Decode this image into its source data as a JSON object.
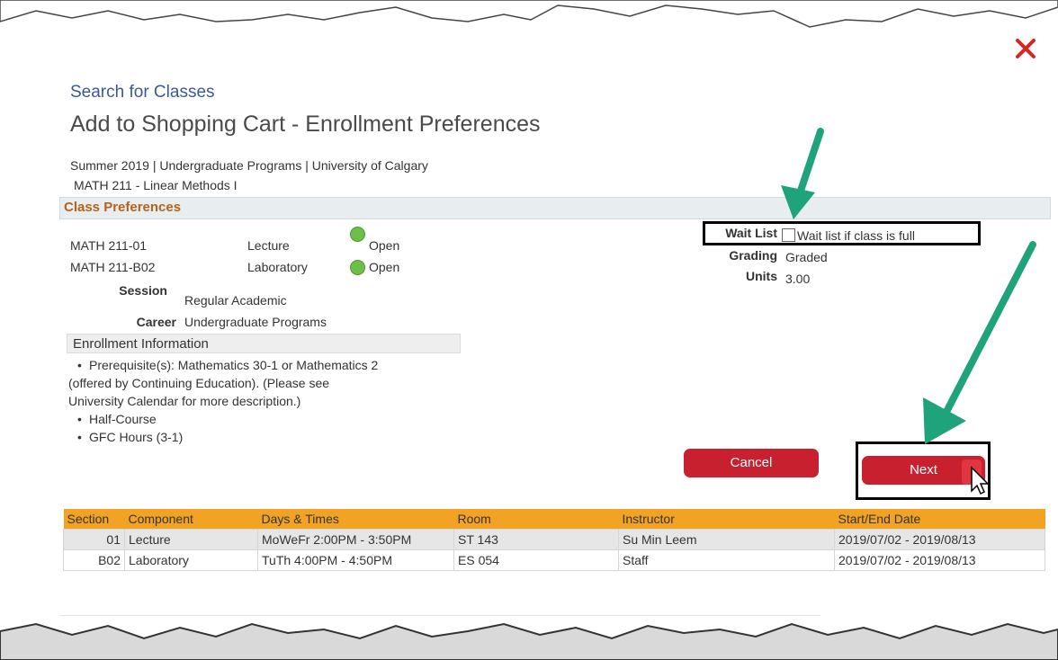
{
  "breadcrumb": {
    "search_link": "Search for Classes"
  },
  "page": {
    "title": "Add to Shopping Cart - Enrollment Preferences"
  },
  "context": {
    "term_line": "Summer 2019 | Undergraduate Programs | University of Calgary",
    "course_line": "MATH  211 - Linear Methods I"
  },
  "class_preferences": {
    "header": "Class Preferences",
    "sections": [
      {
        "section": "MATH  211-01",
        "component": "Lecture",
        "status": "Open"
      },
      {
        "section": "MATH  211-B02",
        "component": "Laboratory",
        "status": "Open"
      }
    ],
    "session_label": "Session",
    "session_value": "Regular Academic",
    "career_label": "Career",
    "career_value": "Undergraduate Programs"
  },
  "enrollment_info": {
    "header": "Enrollment Information",
    "bullet": "•",
    "prereq_lines": [
      "Prerequisite(s): Mathematics 30-1 or Mathematics 2",
      "(offered by Continuing Education). (Please see",
      "University Calendar for more description.)"
    ],
    "half_course": "Half-Course",
    "gfc_hours": "GFC Hours (3-1)"
  },
  "options": {
    "wait_list_label": "Wait List",
    "wait_list_checkbox_label": "Wait list if class is full",
    "wait_list_checked": false,
    "grading_label": "Grading",
    "grading_value": "Graded",
    "units_label": "Units",
    "units_value": "3.00"
  },
  "buttons": {
    "cancel": "Cancel",
    "next": "Next"
  },
  "sections_table": {
    "headers": [
      "Section",
      "Component",
      "Days & Times",
      "Room",
      "Instructor",
      "Start/End Date"
    ],
    "rows": [
      {
        "section": "01",
        "component": "Lecture",
        "days_times": "MoWeFr 2:00PM - 3:50PM",
        "room": "ST 143",
        "instructor": "Su Min Leem",
        "dates": "2019/07/02 - 2019/08/13"
      },
      {
        "section": "B02",
        "component": "Laboratory",
        "days_times": "TuTh 4:00PM - 4:50PM",
        "room": "ES 054",
        "instructor": "Staff",
        "dates": "2019/07/02 - 2019/08/13"
      }
    ]
  },
  "colors": {
    "accent_red": "#c8202f",
    "header_orange": "#f2a323",
    "arrow_green": "#1fa37a",
    "open_green": "#6cc04a",
    "link_blue": "#3b5998"
  }
}
